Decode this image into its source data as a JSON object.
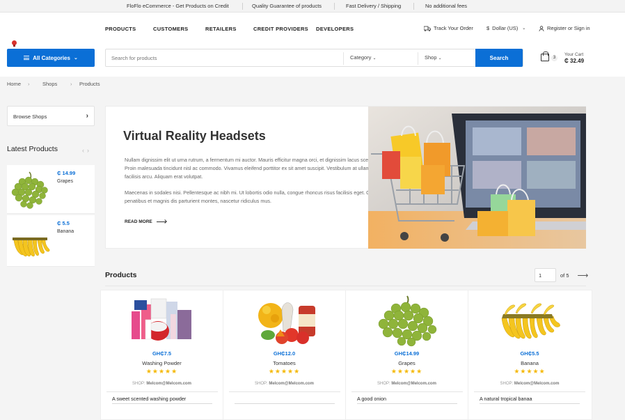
{
  "topbar": {
    "items": [
      "FloFlo eCommerce - Get Products on Credit",
      "Quality Guarantee of products",
      "Fast Delivery / Shipping",
      "No additional fees"
    ]
  },
  "nav": {
    "items": [
      "PRODUCTS",
      "CUSTOMERS",
      "RETAILERS",
      "CREDIT PROVIDERS",
      "DEVELOPERS"
    ]
  },
  "utils": {
    "track": "Track Your Order",
    "currency": "Dollar (US)",
    "account": "Register or Sign in"
  },
  "search": {
    "categories_btn": "All Categories",
    "placeholder": "Search for products",
    "category": "Category",
    "shop": "Shop",
    "button": "Search"
  },
  "cart": {
    "count": "3",
    "label": "Your Cart",
    "amount": "₵ 32.49"
  },
  "breadcrumb": [
    "Home",
    "Shops",
    "Products"
  ],
  "sidebar": {
    "browse": "Browse Shops",
    "latest_title": "Latest Products",
    "latest": [
      {
        "price": "₵ 14.99",
        "name": "Grapes"
      },
      {
        "price": "₵ 5.5",
        "name": "Banana"
      }
    ]
  },
  "hero": {
    "title": "Virtual Reality Headsets",
    "p1": "Nullam dignissim elit ut urna rutrum, a fermentum mi auctor. Mauris efficitur magna orci, et dignissim lacus scelerisque sit amet. Proin malesuada tincidunt nisl ac commodo. Vivamus eleifend porttitor ex sit amet suscipit. Vestibulum at ullamcorper lacus, vel facilisis arcu. Aliquam erat volutpat.",
    "p2": "Maecenas in sodales nisi. Pellentesque ac nibh mi. Ut lobortis odio nulla, congue rhoncus risus facilisis eget. Orci varius natoque penatibus et magnis dis parturient montes, nascetur ridiculus mus.",
    "more": "READ MORE"
  },
  "products": {
    "title": "Products",
    "page": "1",
    "of": "of 5",
    "items": [
      {
        "price": "GH₵7.5",
        "name": "Washing Powder",
        "shop_label": "SHOP:",
        "shop": "Melcom@Melcom.com",
        "desc": "A sweet scented washing powder",
        "rating": 5
      },
      {
        "price": "GH₵12.0",
        "name": "Tomatoes",
        "shop_label": "SHOP:",
        "shop": "Melcom@Melcom.com",
        "desc": "",
        "rating": 5
      },
      {
        "price": "GH₵14.99",
        "name": "Grapes",
        "shop_label": "SHOP:",
        "shop": "Melcom@Melcom.com",
        "desc": "A good onion",
        "rating": 5
      },
      {
        "price": "GH₵5.5",
        "name": "Banana",
        "shop_label": "SHOP:",
        "shop": "Melcom@Melcom.com",
        "desc": "A natural tropical banaa",
        "rating": 5
      }
    ]
  },
  "colors": {
    "accent": "#0b6fd6",
    "star": "#f5b800"
  }
}
